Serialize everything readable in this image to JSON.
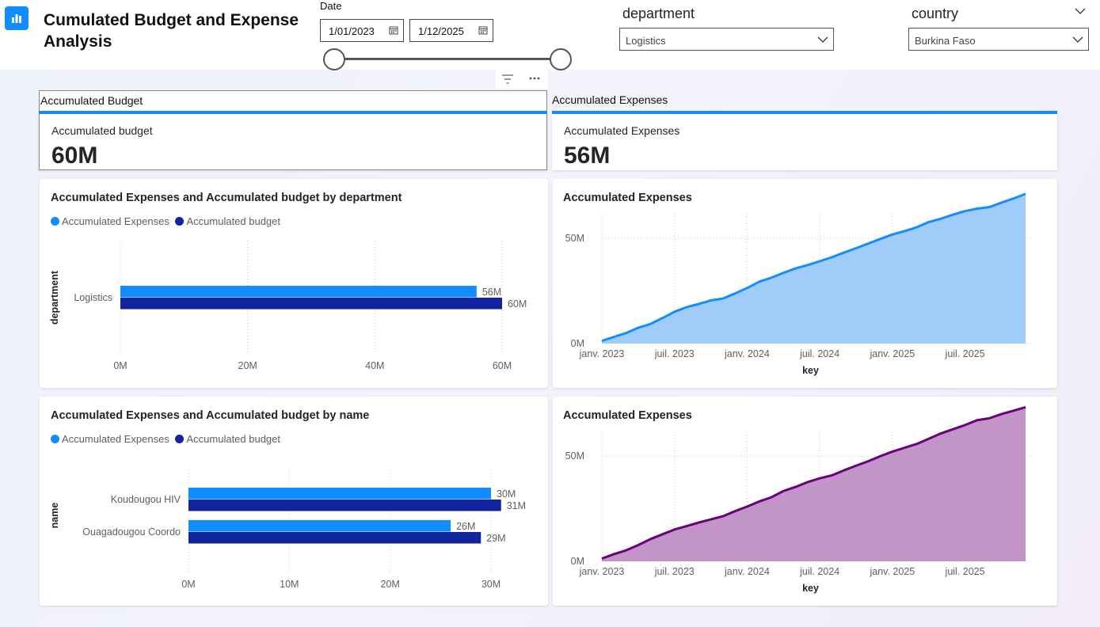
{
  "header": {
    "title": "Cumulated Budget and Expense Analysis",
    "date_slicer": {
      "label": "Date",
      "start": "1/01/2023",
      "end": "1/12/2025"
    },
    "department_slicer": {
      "label": "department",
      "value": "Logistics"
    },
    "country_slicer": {
      "label": "country",
      "value": "Burkina Faso"
    }
  },
  "kpi_budget": {
    "header": "Accumulated Budget",
    "label": "Accumulated budget",
    "value": "60M"
  },
  "kpi_expenses": {
    "header": "Accumulated Expenses",
    "label": "Accumulated Expenses",
    "value": "56M"
  },
  "colors": {
    "expenses": "#118DFF",
    "budget": "#12239E",
    "area_blue": "#9FCCF9",
    "area_purple": "#C294C7",
    "line_purple": "#6B007B"
  },
  "icons": [
    "bar-chart-icon",
    "calendar-icon",
    "chevron-down-icon",
    "filter-icon",
    "more-options-icon"
  ],
  "chart_data": [
    {
      "type": "bar",
      "title": "Accumulated Expenses and Accumulated budget by department",
      "ylabel": "department",
      "categories": [
        "Logistics"
      ],
      "series": [
        {
          "name": "Accumulated Expenses",
          "values": [
            56
          ],
          "labels": [
            "56M"
          ]
        },
        {
          "name": "Accumulated budget",
          "values": [
            60
          ],
          "labels": [
            "60M"
          ]
        }
      ],
      "xticks": [
        "0M",
        "20M",
        "40M",
        "60M"
      ],
      "xlim": [
        0,
        60
      ],
      "legend": "top-left"
    },
    {
      "type": "bar",
      "title": "Accumulated Expenses and Accumulated budget by name",
      "ylabel": "name",
      "categories": [
        "Koudougou HIV",
        "Ouagadougou Coordo"
      ],
      "series": [
        {
          "name": "Accumulated Expenses",
          "values": [
            30,
            26
          ],
          "labels": [
            "30M",
            "26M"
          ]
        },
        {
          "name": "Accumulated budget",
          "values": [
            31,
            29
          ],
          "labels": [
            "31M",
            "29M"
          ]
        }
      ],
      "xticks": [
        "0M",
        "10M",
        "20M",
        "30M"
      ],
      "xlim": [
        0,
        30
      ],
      "legend": "top-left"
    },
    {
      "type": "area",
      "title": "Accumulated Expenses",
      "xlabel": "key",
      "xticks": [
        "janv. 2023",
        "juil. 2023",
        "janv. 2024",
        "juil. 2024",
        "janv. 2025",
        "juil. 2025"
      ],
      "yticks": [
        "0M",
        "50M"
      ],
      "ylim": [
        0,
        50
      ],
      "x": [
        "2023-01",
        "2023-02",
        "2023-03",
        "2023-04",
        "2023-05",
        "2023-06",
        "2023-07",
        "2023-08",
        "2023-09",
        "2023-10",
        "2023-11",
        "2023-12",
        "2024-01",
        "2024-02",
        "2024-03",
        "2024-04",
        "2024-05",
        "2024-06",
        "2024-07",
        "2024-08",
        "2024-09",
        "2024-10",
        "2024-11",
        "2024-12",
        "2025-01",
        "2025-02",
        "2025-03",
        "2025-04",
        "2025-05",
        "2025-06",
        "2025-07",
        "2025-08",
        "2025-09",
        "2025-10",
        "2025-11",
        "2025-12"
      ],
      "y": [
        1.3,
        3.2,
        5.0,
        7.5,
        9.3,
        12.1,
        15.1,
        17.3,
        18.8,
        20.5,
        21.4,
        23.8,
        26.4,
        29.4,
        31.3,
        33.6,
        35.7,
        37.3,
        39.1,
        41.0,
        43.2,
        45.3,
        47.5,
        49.7,
        51.8,
        53.4,
        55.2,
        57.7,
        59.3,
        61.2,
        62.9,
        64.1,
        64.8,
        66.9,
        68.9,
        71.1
      ],
      "grid": true
    },
    {
      "type": "area",
      "title": "Accumulated Expenses",
      "xlabel": "key",
      "xticks": [
        "janv. 2023",
        "juil. 2023",
        "janv. 2024",
        "juil. 2024",
        "janv. 2025",
        "juil. 2025"
      ],
      "yticks": [
        "0M",
        "50M"
      ],
      "ylim": [
        0,
        50
      ],
      "x": [
        "2023-01",
        "2023-02",
        "2023-03",
        "2023-04",
        "2023-05",
        "2023-06",
        "2023-07",
        "2023-08",
        "2023-09",
        "2023-10",
        "2023-11",
        "2023-12",
        "2024-01",
        "2024-02",
        "2024-03",
        "2024-04",
        "2024-05",
        "2024-06",
        "2024-07",
        "2024-08",
        "2024-09",
        "2024-10",
        "2024-11",
        "2024-12",
        "2025-01",
        "2025-02",
        "2025-03",
        "2025-04",
        "2025-05",
        "2025-06",
        "2025-07",
        "2025-08",
        "2025-09",
        "2025-10",
        "2025-11",
        "2025-12"
      ],
      "y": [
        1.3,
        3.4,
        5.2,
        7.7,
        10.5,
        12.8,
        15.1,
        16.7,
        18.4,
        19.9,
        21.4,
        23.8,
        26.0,
        28.4,
        30.4,
        33.4,
        35.3,
        37.6,
        39.4,
        40.8,
        43.2,
        45.4,
        47.5,
        49.9,
        52.1,
        53.9,
        55.7,
        58.2,
        60.7,
        62.7,
        64.7,
        67.0,
        67.9,
        69.9,
        71.5,
        73.2
      ],
      "grid": true
    }
  ]
}
